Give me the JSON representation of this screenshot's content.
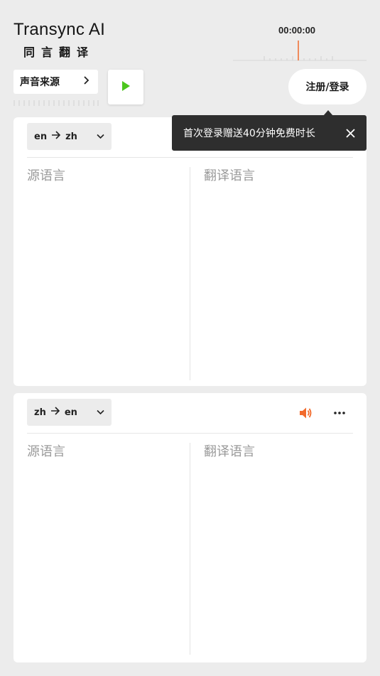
{
  "app": {
    "title": "Transync AI",
    "subtitle": "同言翻译"
  },
  "timer": "00:00:00",
  "source_button": {
    "label": "声音来源"
  },
  "login_button": {
    "label": "注册/登录"
  },
  "tooltip": {
    "text": "首次登录赠送40分钟免费时长"
  },
  "panels": [
    {
      "lang_from": "en",
      "lang_to": "zh",
      "source_label": "源语言",
      "target_label": "翻译语言"
    },
    {
      "lang_from": "zh",
      "lang_to": "en",
      "source_label": "源语言",
      "target_label": "翻译语言"
    }
  ],
  "colors": {
    "accent": "#f26b2c",
    "play": "#4cc61d",
    "background": "#ececec",
    "tooltip_bg": "#2e2e2e"
  },
  "icons": [
    "chevron-right-icon",
    "play-icon",
    "close-icon",
    "arrow-right-icon",
    "chevron-down-icon",
    "speaker-icon",
    "more-icon"
  ]
}
